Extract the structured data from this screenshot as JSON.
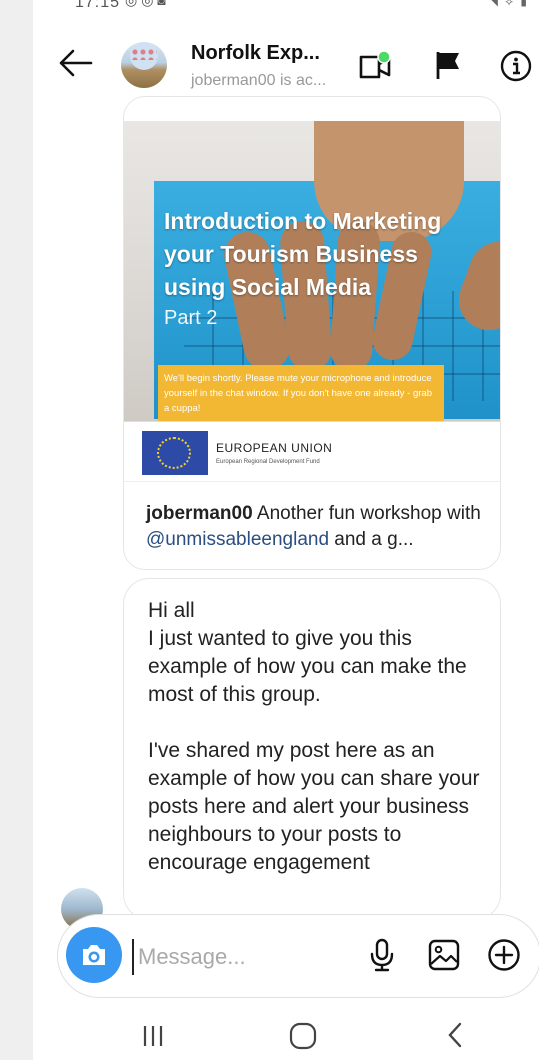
{
  "status_bar": {
    "time": "17:15"
  },
  "header": {
    "title": "Norfolk Exp...",
    "subtitle": "joberman00 is ac..."
  },
  "shared_post": {
    "image_heading": "Introduction to Marketing your Tourism Business using Social Media",
    "image_part": "Part 2",
    "image_note": "We'll begin shortly. Please mute your microphone and introduce yourself in the chat window. If you don't have one already - grab a cuppa!",
    "funder_name": "EUROPEAN UNION",
    "funder_sub": "European Regional Development Fund",
    "caption_user": "joberman00",
    "caption_text": "Another fun workshop with",
    "caption_mention": "@unmissableengland",
    "caption_tail": "and a g..."
  },
  "message": {
    "text": "Hi all\nI just wanted to give you this example of how you can make the most of this group.\n\nI've shared my post here as an example of how you can share your posts here and alert your business neighbours to your posts to encourage engagement"
  },
  "composer": {
    "placeholder": "Message..."
  },
  "colors": {
    "accent": "#3897f0",
    "mention": "#2a4e82",
    "online_dot": "#4cd964"
  },
  "icons": [
    "back-arrow-icon",
    "video-call-icon",
    "flag-icon",
    "info-icon",
    "camera-icon",
    "microphone-icon",
    "gallery-icon",
    "plus-icon",
    "recent-apps-icon",
    "home-icon",
    "back-icon"
  ]
}
